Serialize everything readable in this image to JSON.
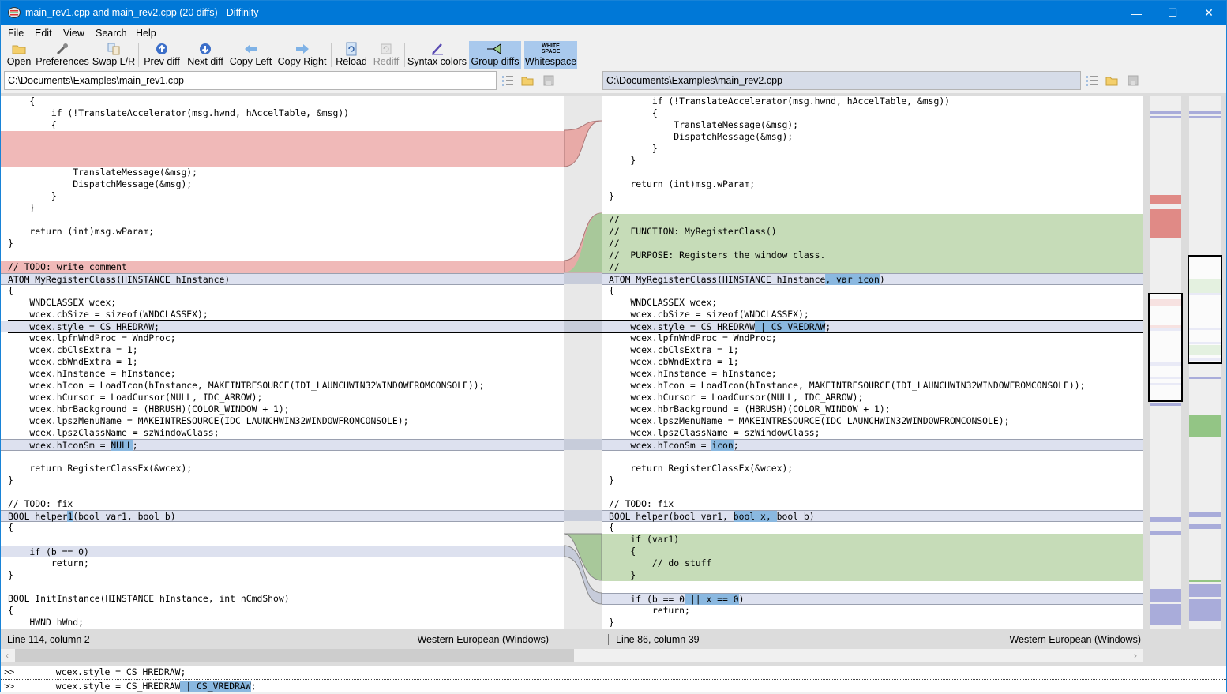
{
  "window": {
    "title": "main_rev1.cpp and main_rev2.cpp (20 diffs) - Diffinity",
    "minimize": "—",
    "maximize": "☐",
    "close": "✕"
  },
  "menu": [
    "File",
    "Edit",
    "View",
    "Search",
    "Help"
  ],
  "toolbar": [
    {
      "label": "Open",
      "icon": "open-folder-icon"
    },
    {
      "label": "Preferences",
      "icon": "wrench-icon"
    },
    {
      "label": "Swap L/R",
      "icon": "swap-icon"
    },
    {
      "label": "Prev diff",
      "icon": "arrow-up-circle-icon"
    },
    {
      "label": "Next diff",
      "icon": "arrow-down-circle-icon"
    },
    {
      "label": "Copy Left",
      "icon": "arrow-left-icon"
    },
    {
      "label": "Copy Right",
      "icon": "arrow-right-icon"
    },
    {
      "label": "Reload",
      "icon": "reload-icon"
    },
    {
      "label": "Rediff",
      "icon": "rediff-icon",
      "disabled": true
    },
    {
      "label": "Syntax colors",
      "icon": "pen-icon"
    },
    {
      "label": "Group diffs",
      "icon": "group-diffs-icon",
      "active": true
    },
    {
      "label": "Whitespace",
      "icon": "whitespace-icon",
      "active": true,
      "icon_text": "WHITE SPACE"
    }
  ],
  "left": {
    "path": "C:\\Documents\\Examples\\main_rev1.cpp",
    "status": "Line 114, column 2",
    "encoding": "Western European (Windows)"
  },
  "right": {
    "path": "C:\\Documents\\Examples\\main_rev2.cpp",
    "status": "Line 86, column 39",
    "encoding": "Western European (Windows)"
  },
  "left_lines": [
    {
      "t": "    {"
    },
    {
      "t": "        if (!TranslateAccelerator(msg.hwnd, hAccelTable, &msg))"
    },
    {
      "t": "        {"
    },
    {
      "t": "",
      "k": "del"
    },
    {
      "t": "",
      "k": "del"
    },
    {
      "t": "",
      "k": "del"
    },
    {
      "t": "            TranslateMessage(&msg);"
    },
    {
      "t": "            DispatchMessage(&msg);"
    },
    {
      "t": "        }"
    },
    {
      "t": "    }"
    },
    {
      "t": ""
    },
    {
      "t": "    return (int)msg.wParam;"
    },
    {
      "t": "}"
    },
    {
      "t": ""
    },
    {
      "t": "// TODO: write comment",
      "k": "del"
    },
    {
      "t": "ATOM MyRegisterClass(HINSTANCE hInstance)",
      "k": "chg"
    },
    {
      "t": "{"
    },
    {
      "t": "    WNDCLASSEX wcex;"
    },
    {
      "t": "    wcex.cbSize = sizeof(WNDCLASSEX);"
    },
    {
      "t": "    wcex.style = CS_HREDRAW;",
      "k": "chg"
    },
    {
      "t": "    wcex.lpfnWndProc = WndProc;"
    },
    {
      "t": "    wcex.cbClsExtra = 1;"
    },
    {
      "t": "    wcex.cbWndExtra = 1;"
    },
    {
      "t": "    wcex.hInstance = hInstance;"
    },
    {
      "t": "    wcex.hIcon = LoadIcon(hInstance, MAKEINTRESOURCE(IDI_LAUNCHWIN32WINDOWFROMCONSOLE));"
    },
    {
      "t": "    wcex.hCursor = LoadCursor(NULL, IDC_ARROW);"
    },
    {
      "t": "    wcex.hbrBackground = (HBRUSH)(COLOR_WINDOW + 1);"
    },
    {
      "t": "    wcex.lpszMenuName = MAKEINTRESOURCE(IDC_LAUNCHWIN32WINDOWFROMCONSOLE);"
    },
    {
      "t": "    wcex.lpszClassName = szWindowClass;"
    },
    {
      "t": "    wcex.hIconSm = NULL;",
      "k": "chg",
      "hl": "NULL"
    },
    {
      "t": ""
    },
    {
      "t": "    return RegisterClassEx(&wcex);"
    },
    {
      "t": "}"
    },
    {
      "t": ""
    },
    {
      "t": "// TODO: fix"
    },
    {
      "t": "BOOL helper1(bool var1, bool b)",
      "k": "chg",
      "hl": "1"
    },
    {
      "t": "{"
    },
    {
      "t": ""
    },
    {
      "t": "    if (b == 0)",
      "k": "chg"
    },
    {
      "t": "        return;"
    },
    {
      "t": "}"
    },
    {
      "t": ""
    },
    {
      "t": "BOOL InitInstance(HINSTANCE hInstance, int nCmdShow)"
    },
    {
      "t": "{"
    },
    {
      "t": "    HWND hWnd;"
    }
  ],
  "right_lines": [
    {
      "t": "        if (!TranslateAccelerator(msg.hwnd, hAccelTable, &msg))"
    },
    {
      "t": "        {"
    },
    {
      "t": "            TranslateMessage(&msg);"
    },
    {
      "t": "            DispatchMessage(&msg);"
    },
    {
      "t": "        }"
    },
    {
      "t": "    }"
    },
    {
      "t": ""
    },
    {
      "t": "    return (int)msg.wParam;"
    },
    {
      "t": "}"
    },
    {
      "t": ""
    },
    {
      "t": "//",
      "k": "add"
    },
    {
      "t": "//  FUNCTION: MyRegisterClass()",
      "k": "add"
    },
    {
      "t": "//",
      "k": "add"
    },
    {
      "t": "//  PURPOSE: Registers the window class.",
      "k": "add"
    },
    {
      "t": "//",
      "k": "add"
    },
    {
      "t": "ATOM MyRegisterClass(HINSTANCE hInstance, var icon)",
      "k": "chg",
      "hl": ", var icon"
    },
    {
      "t": "{"
    },
    {
      "t": "    WNDCLASSEX wcex;"
    },
    {
      "t": "    wcex.cbSize = sizeof(WNDCLASSEX);"
    },
    {
      "t": "    wcex.style = CS_HREDRAW | CS_VREDRAW;",
      "k": "chg",
      "hl": " | CS_VREDRAW"
    },
    {
      "t": "    wcex.lpfnWndProc = WndProc;"
    },
    {
      "t": "    wcex.cbClsExtra = 1;"
    },
    {
      "t": "    wcex.cbWndExtra = 1;"
    },
    {
      "t": "    wcex.hInstance = hInstance;"
    },
    {
      "t": "    wcex.hIcon = LoadIcon(hInstance, MAKEINTRESOURCE(IDI_LAUNCHWIN32WINDOWFROMCONSOLE));"
    },
    {
      "t": "    wcex.hCursor = LoadCursor(NULL, IDC_ARROW);"
    },
    {
      "t": "    wcex.hbrBackground = (HBRUSH)(COLOR_WINDOW + 1);"
    },
    {
      "t": "    wcex.lpszMenuName = MAKEINTRESOURCE(IDC_LAUNCHWIN32WINDOWFROMCONSOLE);"
    },
    {
      "t": "    wcex.lpszClassName = szWindowClass;"
    },
    {
      "t": "    wcex.hIconSm = icon;",
      "k": "chg",
      "hl": "icon"
    },
    {
      "t": ""
    },
    {
      "t": "    return RegisterClassEx(&wcex);"
    },
    {
      "t": "}"
    },
    {
      "t": ""
    },
    {
      "t": "// TODO: fix"
    },
    {
      "t": "BOOL helper(bool var1, bool x, bool b)",
      "k": "chg",
      "hl": "bool x, "
    },
    {
      "t": "{"
    },
    {
      "t": "    if (var1)",
      "k": "add"
    },
    {
      "t": "    {",
      "k": "add"
    },
    {
      "t": "        // do stuff",
      "k": "add"
    },
    {
      "t": "    }",
      "k": "add"
    },
    {
      "t": ""
    },
    {
      "t": "    if (b == 0 || x == 0)",
      "k": "chg",
      "hl": " || x == 0"
    },
    {
      "t": "        return;"
    },
    {
      "t": "}"
    }
  ],
  "compare": {
    "prompt": ">>",
    "left": "    wcex.style = CS_HREDRAW;",
    "right": "    wcex.style = CS_HREDRAW | CS_VREDRAW;",
    "right_hl": " | CS_VREDRAW"
  },
  "colors": {
    "title": "#0078d7",
    "deleted": "#f0b9b8",
    "added": "#c6dcb8",
    "changed": "#dde1ef",
    "inline": "#8ab8e0",
    "map_del": "#e08a86",
    "map_add": "#93c585",
    "map_chg": "#a9acda"
  }
}
